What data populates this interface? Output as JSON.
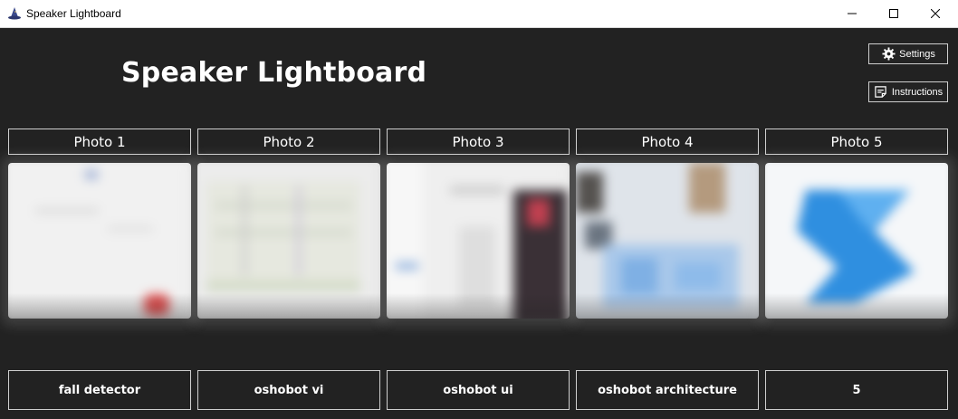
{
  "window": {
    "title": "Speaker Lightboard",
    "icon": "wizard-hat-icon",
    "controls": {
      "minimize": "minimize-icon",
      "maximize": "maximize-icon",
      "close": "close-icon"
    }
  },
  "app": {
    "heading": "Speaker Lightboard",
    "settings_label": "Settings",
    "settings_icon": "gear-icon",
    "instructions_label": "Instructions",
    "instructions_icon": "note-icon"
  },
  "colors": {
    "background": "#222222",
    "border": "#cfcfcf",
    "text": "#ffffff",
    "titlebar": "#ffffff"
  },
  "photos": [
    {
      "header": "Photo 1",
      "name": "fall detector"
    },
    {
      "header": "Photo 2",
      "name": "oshobot vi"
    },
    {
      "header": "Photo 3",
      "name": "oshobot ui"
    },
    {
      "header": "Photo 4",
      "name": "oshobot architecture"
    },
    {
      "header": "Photo 5",
      "name": "5"
    }
  ]
}
